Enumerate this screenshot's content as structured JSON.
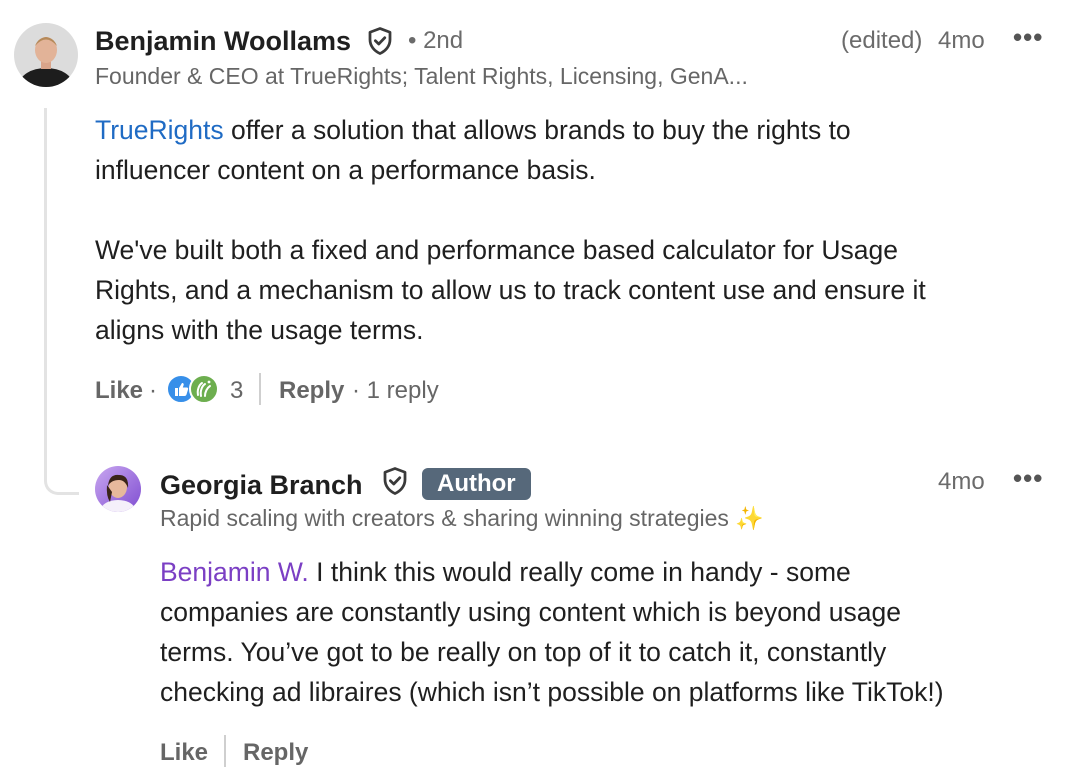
{
  "comment": {
    "author": "Benjamin Woollams",
    "degree": "• 2nd",
    "edited": "(edited)",
    "time": "4mo",
    "headline": "Founder & CEO at TrueRights; Talent Rights, Licensing, GenA...",
    "mention": "TrueRights",
    "text_line1_rest": " offer a solution that allows brands to buy the rights to",
    "text_line2": "influencer content on a performance basis.",
    "text_para2_line1": "We've built both a fixed and performance based calculator for Usage",
    "text_para2_line2": "Rights, and a mechanism to allow us to track content use and ensure it",
    "text_para2_line3": "aligns with the usage terms.",
    "like_label": "Like",
    "dot": "·",
    "reaction_count": "3",
    "reply_label": "Reply",
    "reply_count": "· 1 reply",
    "more_icon": "more-horizontal-icon",
    "verified_icon": "verified-shield-icon"
  },
  "reply": {
    "author": "Georgia Branch",
    "badge": "Author",
    "time": "4mo",
    "headline": "Rapid scaling with creators & sharing winning strategies ✨",
    "mention": "Benjamin W.",
    "text_line1_rest": " I think this would really come in handy - some",
    "text_line2": "companies are constantly using content which is beyond usage",
    "text_line3": "terms. You’ve got to be really on top of it to catch it, constantly",
    "text_line4": "checking ad libraires (which isn’t possible on platforms like TikTok!)",
    "like_label": "Like",
    "reply_label": "Reply"
  },
  "colors": {
    "mention_blue": "#1f6bc4",
    "mention_purple": "#7b3fc4",
    "badge_bg": "#56687a",
    "muted_text": "#666666"
  }
}
